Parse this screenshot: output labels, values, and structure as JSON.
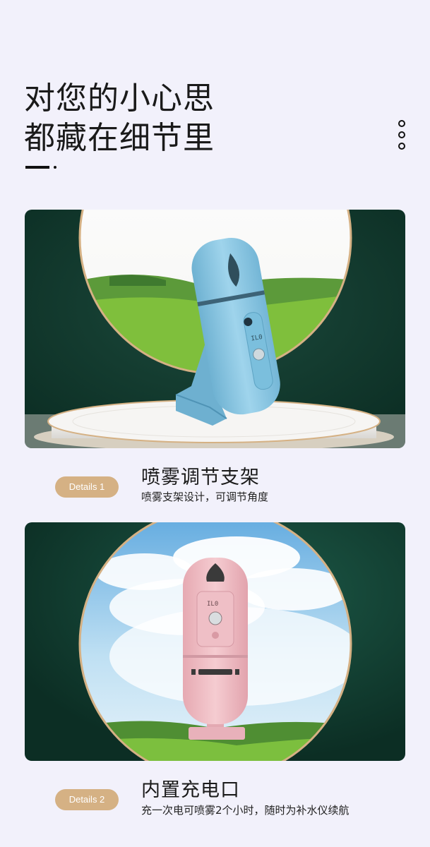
{
  "header": {
    "headline_line1": "对您的小心思",
    "headline_line2": "都藏在细节里"
  },
  "features": [
    {
      "badge": "Details 1",
      "title": "喷雾调节支架",
      "subtitle": "喷雾支架设计，可调节角度",
      "device_color": "#8ec9e6",
      "device_display": "IL0"
    },
    {
      "badge": "Details 2",
      "title": "内置充电口",
      "subtitle": "充一次电可喷雾2个小时，随时为补水仪续航",
      "device_color": "#f0c2c8",
      "device_display": "IL0"
    }
  ],
  "colors": {
    "background": "#f2f1fb",
    "card_green": "#0f3a2e",
    "gold_ring": "#d5b184",
    "badge": "#d5b184"
  }
}
